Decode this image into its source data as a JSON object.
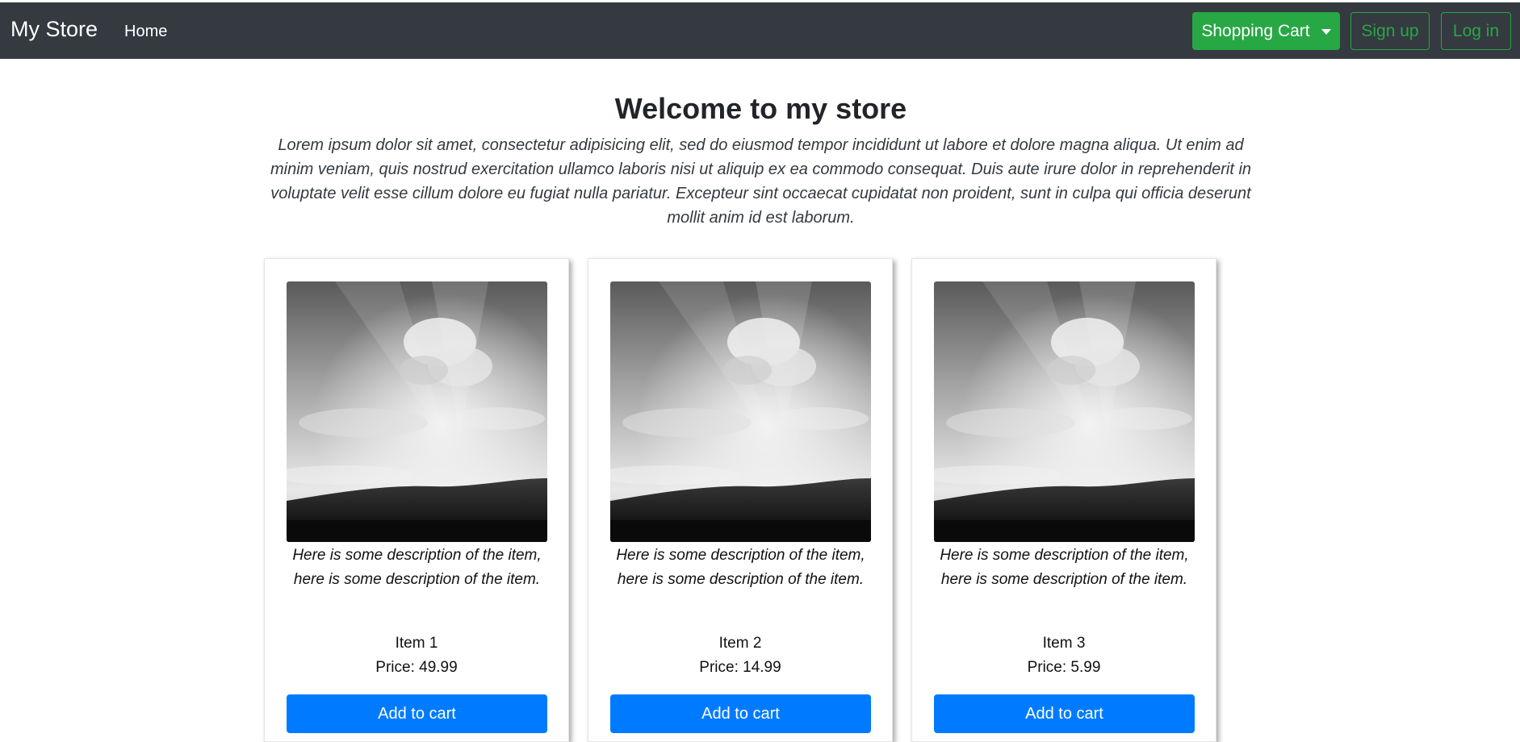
{
  "navbar": {
    "brand": "My Store",
    "home_label": "Home",
    "cart_label": "Shopping Cart",
    "signup_label": "Sign up",
    "login_label": "Log in"
  },
  "hero": {
    "title": "Welcome to my store",
    "text": "Lorem ipsum dolor sit amet, consectetur adipisicing elit, sed do eiusmod tempor incididunt ut labore et dolore magna aliqua. Ut enim ad minim veniam, quis nostrud exercitation ullamco laboris nisi ut aliquip ex ea commodo consequat. Duis aute irure dolor in reprehenderit in voluptate velit esse cillum dolore eu fugiat nulla pariatur. Excepteur sint occaecat cupidatat non proident, sunt in culpa qui officia deserunt mollit anim id est laborum."
  },
  "products": [
    {
      "description": "Here is some description of the item, here is some description of the item.",
      "name": "Item 1",
      "price": "Price: 49.99",
      "button_label": "Add to cart"
    },
    {
      "description": "Here is some description of the item, here is some description of the item.",
      "name": "Item 2",
      "price": "Price: 14.99",
      "button_label": "Add to cart"
    },
    {
      "description": "Here is some description of the item, here is some description of the item.",
      "name": "Item 3",
      "price": "Price: 5.99",
      "button_label": "Add to cart"
    }
  ],
  "colors": {
    "navbar_bg": "#343a40",
    "success": "#28a745",
    "primary": "#007bff"
  }
}
